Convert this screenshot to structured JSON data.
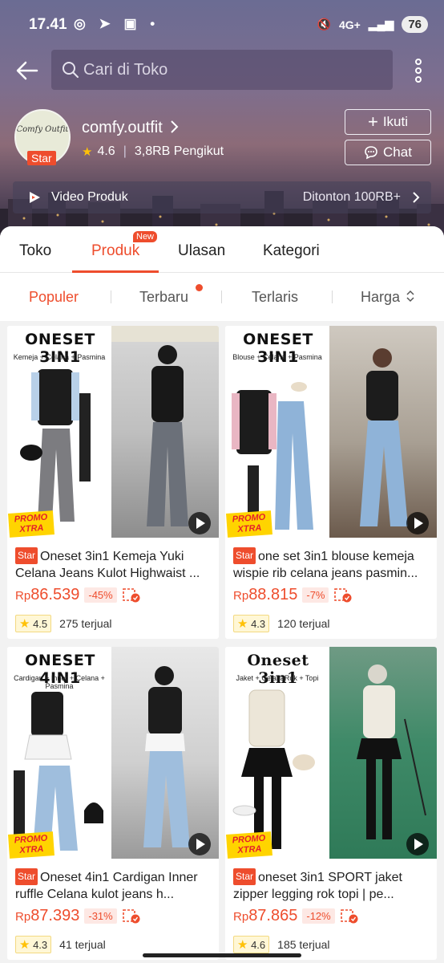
{
  "status_bar": {
    "time": "17.41",
    "network": "4G+",
    "battery": "76"
  },
  "search": {
    "placeholder": "Cari di Toko"
  },
  "shop": {
    "name": "comfy.outfit",
    "logo_text": "Comfy Outfit",
    "badge": "Star",
    "rating": "4.6",
    "followers": "3,8RB Pengikut",
    "follow_label": "Ikuti",
    "chat_label": "Chat"
  },
  "video_bar": {
    "label": "Video Produk",
    "views": "Ditonton 100RB+"
  },
  "tabs": [
    {
      "label": "Toko"
    },
    {
      "label": "Produk",
      "badge": "New"
    },
    {
      "label": "Ulasan"
    },
    {
      "label": "Kategori"
    }
  ],
  "sorts": [
    {
      "label": "Populer"
    },
    {
      "label": "Terbaru"
    },
    {
      "label": "Terlaris"
    },
    {
      "label": "Harga"
    }
  ],
  "products": [
    {
      "img_title": "ONESET 3IN1",
      "img_sub": "Kemeja + Celana + Pasmina",
      "badge": "Star",
      "title": "Oneset 3in1 Kemeja Yuki Celana Jeans Kulot Highwaist ...",
      "currency": "Rp",
      "price": "86.539",
      "discount": "-45%",
      "rating": "4.5",
      "sold": "275 terjual"
    },
    {
      "img_title": "ONESET 3IN1",
      "img_sub": "Blouse + Celana + Pasmina",
      "badge": "Star",
      "title": "one set 3in1 blouse kemeja wispie rib celana jeans pasmin...",
      "currency": "Rp",
      "price": "88.815",
      "discount": "-7%",
      "rating": "4.3",
      "sold": "120 terjual"
    },
    {
      "img_title": "ONESET 4IN1",
      "img_sub": "Cardigan + Inner + Celana + Pasmina",
      "badge": "Star",
      "title": "Oneset 4in1 Cardigan Inner ruffle Celana kulot jeans h...",
      "currency": "Rp",
      "price": "87.393",
      "discount": "-31%",
      "rating": "4.3",
      "sold": "41 terjual"
    },
    {
      "img_title": "Oneset 3in1",
      "img_sub": "Jaket + CelanaRok + Topi",
      "badge": "Star",
      "title": "oneset 3in1 SPORT jaket zipper legging rok topi | pe...",
      "currency": "Rp",
      "price": "87.865",
      "discount": "-12%",
      "rating": "4.6",
      "sold": "185 terjual"
    }
  ],
  "promo_label": "PROMO XTRA",
  "colors": {
    "accent": "#ee4d2d",
    "star": "#ffc107"
  }
}
